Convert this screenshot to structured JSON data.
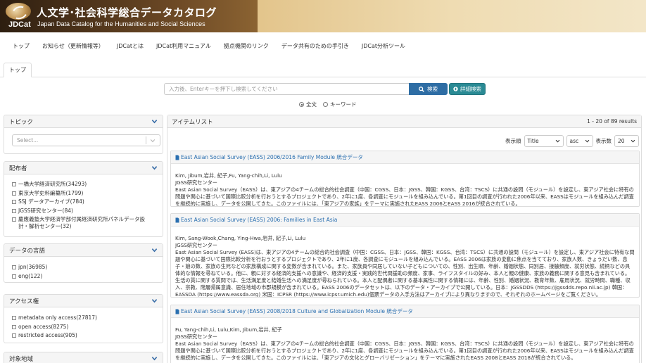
{
  "banner": {
    "logo_mark_text": "JDCat",
    "title": "人文学･社会科学総合データカタログ",
    "subtitle": "Japan Data Catalog for the Humanities and Social Sciences"
  },
  "nav": {
    "items": [
      "トップ",
      "お知らせ（更新情報等）",
      "JDCatとは",
      "JDCat利用マニュアル",
      "拠点機関のリンク",
      "データ共有のための手引き",
      "JDCat分析ツール"
    ]
  },
  "tabs": {
    "top": "トップ"
  },
  "search": {
    "placeholder": "入力後、Enterキーを押下し検索してください",
    "button_label": "検索",
    "advanced_label": "詳細検索",
    "radio_fulltext": "全文",
    "radio_keyword": "キーワード",
    "selected_mode": "全文"
  },
  "sidebar": {
    "topic": {
      "title": "トピック",
      "select_placeholder": "Select..."
    },
    "distributor": {
      "title": "配布者",
      "items": [
        "一橋大学経済研究所(34293)",
        "東京大学史料編纂所(1799)",
        "SSJ データアーカイブ(784)",
        "JGSS研究センター(84)",
        "慶應義塾大学経済学部付属経済研究所パネルデータ設計・解析センター(32)"
      ]
    },
    "language": {
      "title": "データの言語",
      "items": [
        "jpn(36985)",
        "eng(122)"
      ]
    },
    "access": {
      "title": "アクセス権",
      "items": [
        "metadata only access(27817)",
        "open access(8275)",
        "restricted access(905)"
      ]
    },
    "region": {
      "title": "対象地域"
    }
  },
  "results": {
    "title": "アイテムリスト",
    "count": "1 - 20 of 89 results",
    "display_order_label": "表示順",
    "sort_field": "Title",
    "sort_dir": "asc",
    "per_page_label": "表示数",
    "per_page": "20",
    "items": [
      {
        "title": "East Asian Social Survey (EASS) 2006/2016 Family Module 統合データ",
        "authors": "Kim, Jibum,岩井, 紀子,Fu, Yang-chih,Li, Lulu",
        "publisher": "JGSS研究センター",
        "description": "East Asian Social Survey（EASS）は、東アジアの4チームの総合的社会調査（中国：CGSS、日本：JGSS、韓国：KGSS、台湾：TSCS）に共通の設問（モジュール）を設定し、東アジア社会に特有の問題や関心に基づいて国際比較分析を行おうとするプロジェクトであり、2年に1度、各調査にモジュールを組み込んでいる。第1回目の調査が行われた2006年以来、EASSはモジュールを組み込んだ調査を継続的に実施し、データを公開してきた。このファイルには、「東アジアの家族」をテーマに実施されたEASS 2006とEASS 2016が統合されている。"
      },
      {
        "title": "East Asian Social Survey (EASS) 2006: Families in East Asia",
        "authors": "Kim, Sang-Wook,Chang, Ying-Hwa,岩井, 紀子,Li, Lulu",
        "publisher": "JGSS研究センター",
        "description": "East Asian Social Survey (EASS)は、東アジアの4チームの総合的社会調査（中国：CGSS、日本：JGSS、韓国：KGSS、台湾：TSCS）に共通の設問（モジュール）を設定し、東アジア社会に特有な問題や関心に基づいて国際比較分析を行おうとするプロジェクトであり、2年に1度、各調査にモジュールを組み込んでいる。EASS 2006は家族の変動に焦点を当てており、家族人数、きょうだい数、息子・娘の数、家族の生死などの家族構成に関する変数が含まれている。また、家族員や同居していない子どもについての、性別、出生順、年齢、婚姻状態、同別居、接触頻度、就労状態、続柄などの具体的な情報を尋ねている。他に、親に対する経済的支援への意識や、経済的支援・実践的世代間援助の頻度、家事、ライフスタイルの好み、本人と親の健康、家族の義務に関する意見も含まれている。生活の質に関する質問では、生活満足度と結婚生活への満足度が尋ねられている。本人と配偶者に関する基本属性に関する情報には、年齢、性別、婚姻状況、教育年数、雇用状況、就労時間、職種、収入、宗教、階層帰属意識、居住地域の市郡規模が含まれている。EASS 2006のデータセットは、以下のデータ・アーカイブで公開している。日本：JGSSDDS (https://jgssdds.repo.nii.ac.jp) 韓国：EASSDA (https://www.eassda.org) 米国：ICPSR (https://www.icpsr.umich.edu)個票データの入手方法はアーカイブにより異なりますので、それぞれのホームページをご覧ください。"
      },
      {
        "title": "East Asian Social Survey (EASS) 2008/2018 Culture and Globalization Module 統合データ",
        "authors": "Fu, Yang-chih,Li, Lulu,Kim, Jibum,岩井, 紀子",
        "publisher": "JGSS研究センター",
        "description": "East Asian Social Survey（EASS）は、東アジアの4チームの総合的社会調査（中国：CGSS、日本：JGSS、韓国：KGSS、台湾：TSCS）に共通の設問（モジュール）を設定し、東アジア社会に特有の問題や関心に基づいて国際比較分析を行おうとするプロジェクトであり、2年に1度、各調査にモジュールを組み込んでいる。第1回目の調査が行われた2006年以来、EASSはモジュールを組み込んだ調査を継続的に実施し、データを公開してきた。このファイルには、「東アジアの文化とグローバリゼーション」をテーマに実施されたEASS 2008とEASS 2018が統合されている。"
      }
    ]
  },
  "colors": {
    "link": "#2a6fb0",
    "search_button": "#2e6da4",
    "advanced_button": "#2a8a94"
  },
  "icons": {
    "search": "search-icon",
    "advanced": "plus-icon",
    "chevron": "chevron-down-icon",
    "doc": "document-icon"
  }
}
